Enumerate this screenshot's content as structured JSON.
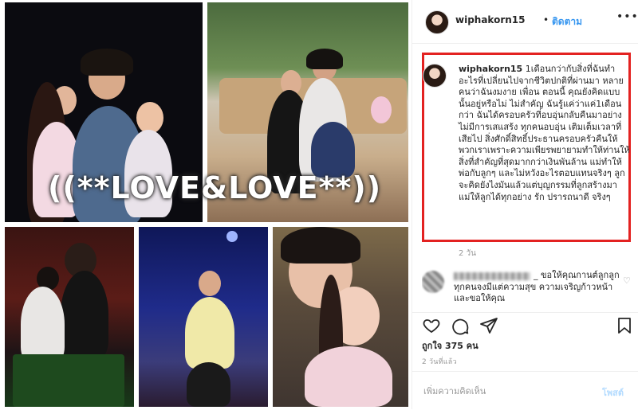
{
  "collage": {
    "overlay_text": "((**LOVE&LOVE**))"
  },
  "header": {
    "username": "wiphakorn15",
    "separator": "•",
    "follow_label": "ติดตาม",
    "more_icon": "more-horizontal-icon"
  },
  "caption": {
    "username": "wiphakorn15",
    "text": "1เดือนกว่ากับสิ่งที่ฉันทำอะไรที่เปลี่ยนไปจากชีวิตปกติที่ผ่านมา หลายคนว่าฉันงมงาย เพื่อน ตอนนี้ คุณยังคิดแบบนั้นอยู่หรือไม่ ไม่สำคัญ ฉันรู้แค่ว่าแค่1เดือนกว่า ฉันได้ครอบครัวที่อบอุ่นกลับคืนมาอย่างไม่มีการเสแสร้ง ทุกคนอบอุ่น เติมเต็มเวลาที่เสียไป สิ่งศักดิ์สิทธิ์ประธานครอบครัวคืนให้พวกเราเพราะความเพียรพยายามทำให้ท่านให้สิ่งที่สำคัญที่สุดมากกว่าเงินพันล้าน แม่ทำให้พ่อกับลูกๆ และไม่หวังอะไรตอบแทนจริงๆ ลูกจะคิดยังไงมันแล้วแต่บุญกรรมที่ลูกสร้างมา แม่ให้ลูกได้ทุกอย่าง รัก ปรารถนาดี จริงๆ",
    "time": "2 วัน"
  },
  "comment": {
    "text": "_ ขอให้คุณกานต์ลูกลูกทุกคนจงมีแต่ความสุข ความเจริญก้าวหน้าและขอให้คุณ"
  },
  "actions": {
    "like_icon": "heart-icon",
    "comment_icon": "comment-icon",
    "share_icon": "share-icon",
    "save_icon": "bookmark-icon"
  },
  "likes": "ถูกใจ 375 คน",
  "date": "2 วันที่แล้ว",
  "add_comment": {
    "placeholder": "เพิ่มความคิดเห็น",
    "post_label": "โพสต์"
  },
  "colors": {
    "accent": "#3897f0",
    "highlight_border": "#e32221",
    "post_disabled": "#b3dbff"
  }
}
